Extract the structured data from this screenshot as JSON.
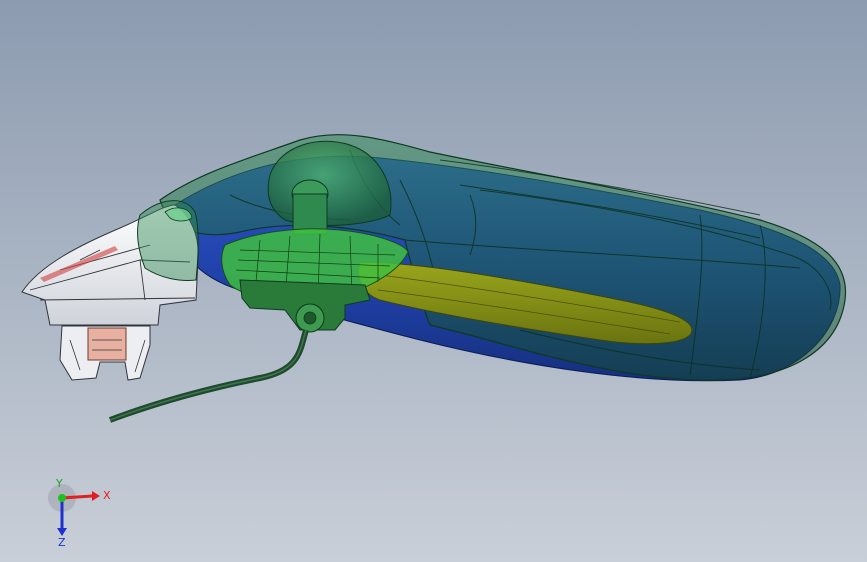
{
  "viewport": {
    "background_top": "#8c9bb0",
    "background_bottom": "#c9cfd8"
  },
  "model": {
    "handle_shell_color": "#1d6b3f",
    "inner_body_color": "#1f3fa6",
    "insert_panel_color": "#7b8a14",
    "sensor_module_color": "#3fbf3f",
    "bracket_color": "#f2f2f2",
    "connector_color": "#e8b0a0",
    "cable_color": "#1f4a2e"
  },
  "triad": {
    "x_label": "X",
    "y_label": "Y",
    "z_label": "Z",
    "x_color": "#e02020",
    "y_color": "#20c020",
    "z_color": "#2030d0"
  }
}
